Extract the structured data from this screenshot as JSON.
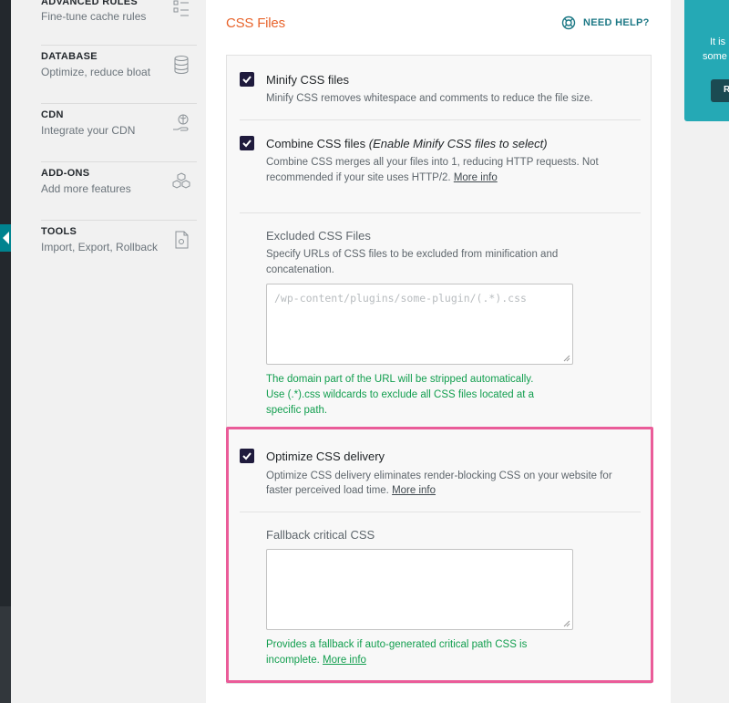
{
  "sidebar": {
    "items": [
      {
        "title": "ADVANCED RULES",
        "desc": "Fine-tune cache rules",
        "icon": "list-icon"
      },
      {
        "title": "DATABASE",
        "desc": "Optimize, reduce bloat",
        "icon": "database-icon"
      },
      {
        "title": "CDN",
        "desc": "Integrate your CDN",
        "icon": "cdn-hand-icon"
      },
      {
        "title": "ADD-ONS",
        "desc": "Add more features",
        "icon": "cubes-icon"
      },
      {
        "title": "TOOLS",
        "desc": "Import, Export, Rollback",
        "icon": "tools-file-icon"
      }
    ],
    "active": "TOOLS"
  },
  "section": {
    "title": "CSS Files",
    "help_label": "NEED HELP?"
  },
  "options": {
    "minify": {
      "title": "Minify CSS files",
      "desc": "Minify CSS removes whitespace and comments to reduce the file size.",
      "checked": true
    },
    "combine": {
      "title": "Combine CSS files",
      "hint": "(Enable Minify CSS files to select)",
      "desc_line1": "Combine CSS merges all your files into 1, reducing HTTP requests. Not",
      "desc_line2": "recommended if your site uses HTTP/2.",
      "link": "More info",
      "checked": true
    },
    "excluded": {
      "label": "Excluded CSS Files",
      "desc_line1": "Specify URLs of CSS files to be excluded from minification and",
      "desc_line2": "concatenation.",
      "placeholder": "/wp-content/plugins/some-plugin/(.*).css",
      "note_line1": "The domain part of the URL will be stripped automatically.",
      "note_line2": "Use (.*).css wildcards to exclude all CSS files located at a",
      "note_line3": "specific path."
    },
    "optimize_delivery": {
      "title": "Optimize CSS delivery",
      "desc_line1": "Optimize CSS delivery eliminates render-blocking CSS on your website for",
      "desc_line2": "faster perceived load time.",
      "link": "More info",
      "checked": true
    },
    "fallback": {
      "label": "Fallback critical CSS",
      "value": "",
      "note_line1": "Provides a fallback if auto-generated critical path CSS is",
      "note_line2": "incomplete.",
      "link": "More info"
    }
  },
  "promo": {
    "line1": "It is",
    "line2": "some",
    "button": "R"
  },
  "colors": {
    "accent_orange": "#e8642c",
    "teal": "#1c7885",
    "checkbox": "#1f1b3d",
    "note_green": "#119e4e",
    "highlight_pink": "#ea5c99"
  }
}
